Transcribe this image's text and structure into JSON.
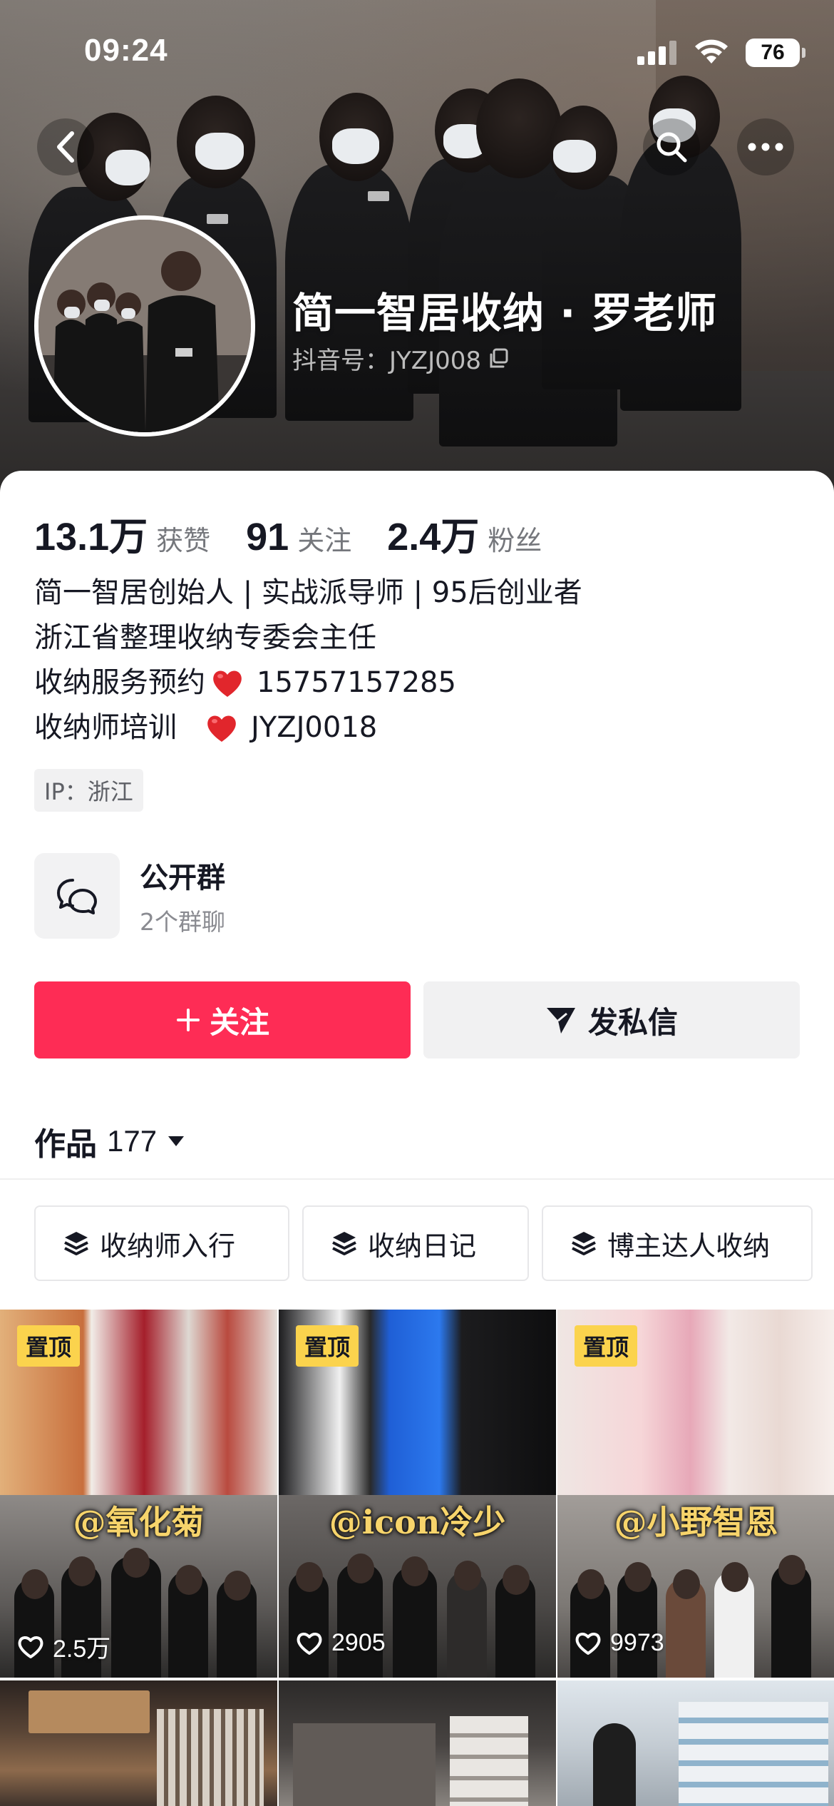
{
  "status_bar": {
    "time": "09:24",
    "battery": "76"
  },
  "profile": {
    "name": "简一智居收纳 · 罗老师",
    "douyin_id": "抖音号：JYZJ008"
  },
  "stats": [
    {
      "value": "13.1万",
      "label": "获赞"
    },
    {
      "value": "91",
      "label": "关注"
    },
    {
      "value": "2.4万",
      "label": "粉丝"
    }
  ],
  "bio": {
    "line1": "简一智居创始人 | 实战派导师 | 95后创业者",
    "line2": "浙江省整理收纳专委会主任",
    "line3_text": "收纳服务预约",
    "line3_value": "15757157285",
    "line4_text": "收纳师培训",
    "line4_value": "JYZJ0018"
  },
  "ip_tag": "IP：浙江",
  "group": {
    "title": "公开群",
    "subtitle": "2个群聊"
  },
  "buttons": {
    "follow": "关注",
    "message": "发私信"
  },
  "works": {
    "label": "作品",
    "count": "177"
  },
  "collections": [
    "收纳师入行",
    "收纳日记",
    "博主达人收纳"
  ],
  "videos": [
    {
      "pinned": "置顶",
      "mention": "@氧化菊",
      "likes": "2.5万"
    },
    {
      "pinned": "置顶",
      "mention": "@icon冷少",
      "likes": "2905"
    },
    {
      "pinned": "置顶",
      "mention": "@小野智恩",
      "likes": "9973"
    }
  ],
  "colors": {
    "accent": "#fe2c55",
    "pin": "#fbd34d"
  }
}
